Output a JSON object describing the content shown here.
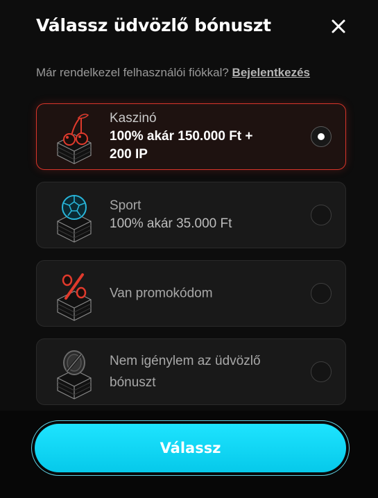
{
  "header": {
    "title": "Válassz üdvözlő bónuszt"
  },
  "login": {
    "prompt": "Már rendelkezel felhasználói fiókkal?",
    "link_label": "Bejelentkezés"
  },
  "options": [
    {
      "title": "Kaszinó",
      "subtitle": "100% akár 150.000 Ft + 200 IP",
      "icon": "cherries-icon",
      "selected": true
    },
    {
      "title": "Sport",
      "subtitle": "100% akár 35.000 Ft",
      "icon": "soccer-ball-icon",
      "selected": false
    },
    {
      "title": "Van promokódom",
      "icon": "percent-icon",
      "selected": false
    },
    {
      "title": "Nem igénylem az üdvözlő bónuszt",
      "icon": "no-bonus-coin-icon",
      "selected": false
    }
  ],
  "footer": {
    "submit_label": "Válassz"
  },
  "colors": {
    "accent_red": "#d8352a",
    "cta_cyan": "#1ee4ff",
    "background": "#0d0d0d"
  }
}
